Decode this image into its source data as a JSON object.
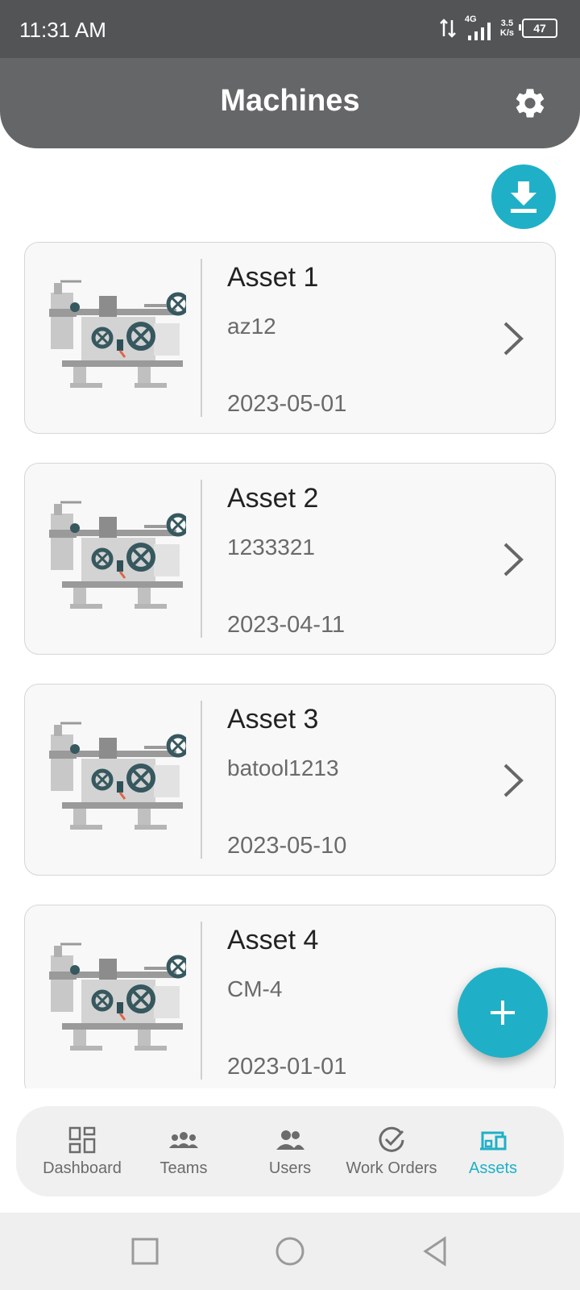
{
  "status_bar": {
    "time": "11:31 AM",
    "network_type": "4G",
    "speed_value": "3.5",
    "speed_unit": "K/s",
    "battery": "47"
  },
  "header": {
    "title": "Machines",
    "settings_icon": "gear-icon"
  },
  "actions": {
    "download_icon": "download-icon",
    "add_icon": "plus-icon"
  },
  "assets": [
    {
      "name": "Asset 1",
      "code": "az12",
      "date": "2023-05-01"
    },
    {
      "name": "Asset 2",
      "code": "1233321",
      "date": "2023-04-11"
    },
    {
      "name": "Asset 3",
      "code": "batool1213",
      "date": "2023-05-10"
    },
    {
      "name": "Asset 4",
      "code": "CM-4",
      "date": "2023-01-01"
    }
  ],
  "bottom_nav": {
    "items": [
      {
        "label": "Dashboard",
        "icon": "dashboard-icon"
      },
      {
        "label": "Teams",
        "icon": "teams-icon"
      },
      {
        "label": "Users",
        "icon": "users-icon"
      },
      {
        "label": "Work Orders",
        "icon": "check-circle-icon"
      },
      {
        "label": "Assets",
        "icon": "assets-icon"
      }
    ],
    "active": "Assets"
  },
  "colors": {
    "accent": "#1fb0c7",
    "header": "#656668",
    "status_bar": "#535456"
  }
}
